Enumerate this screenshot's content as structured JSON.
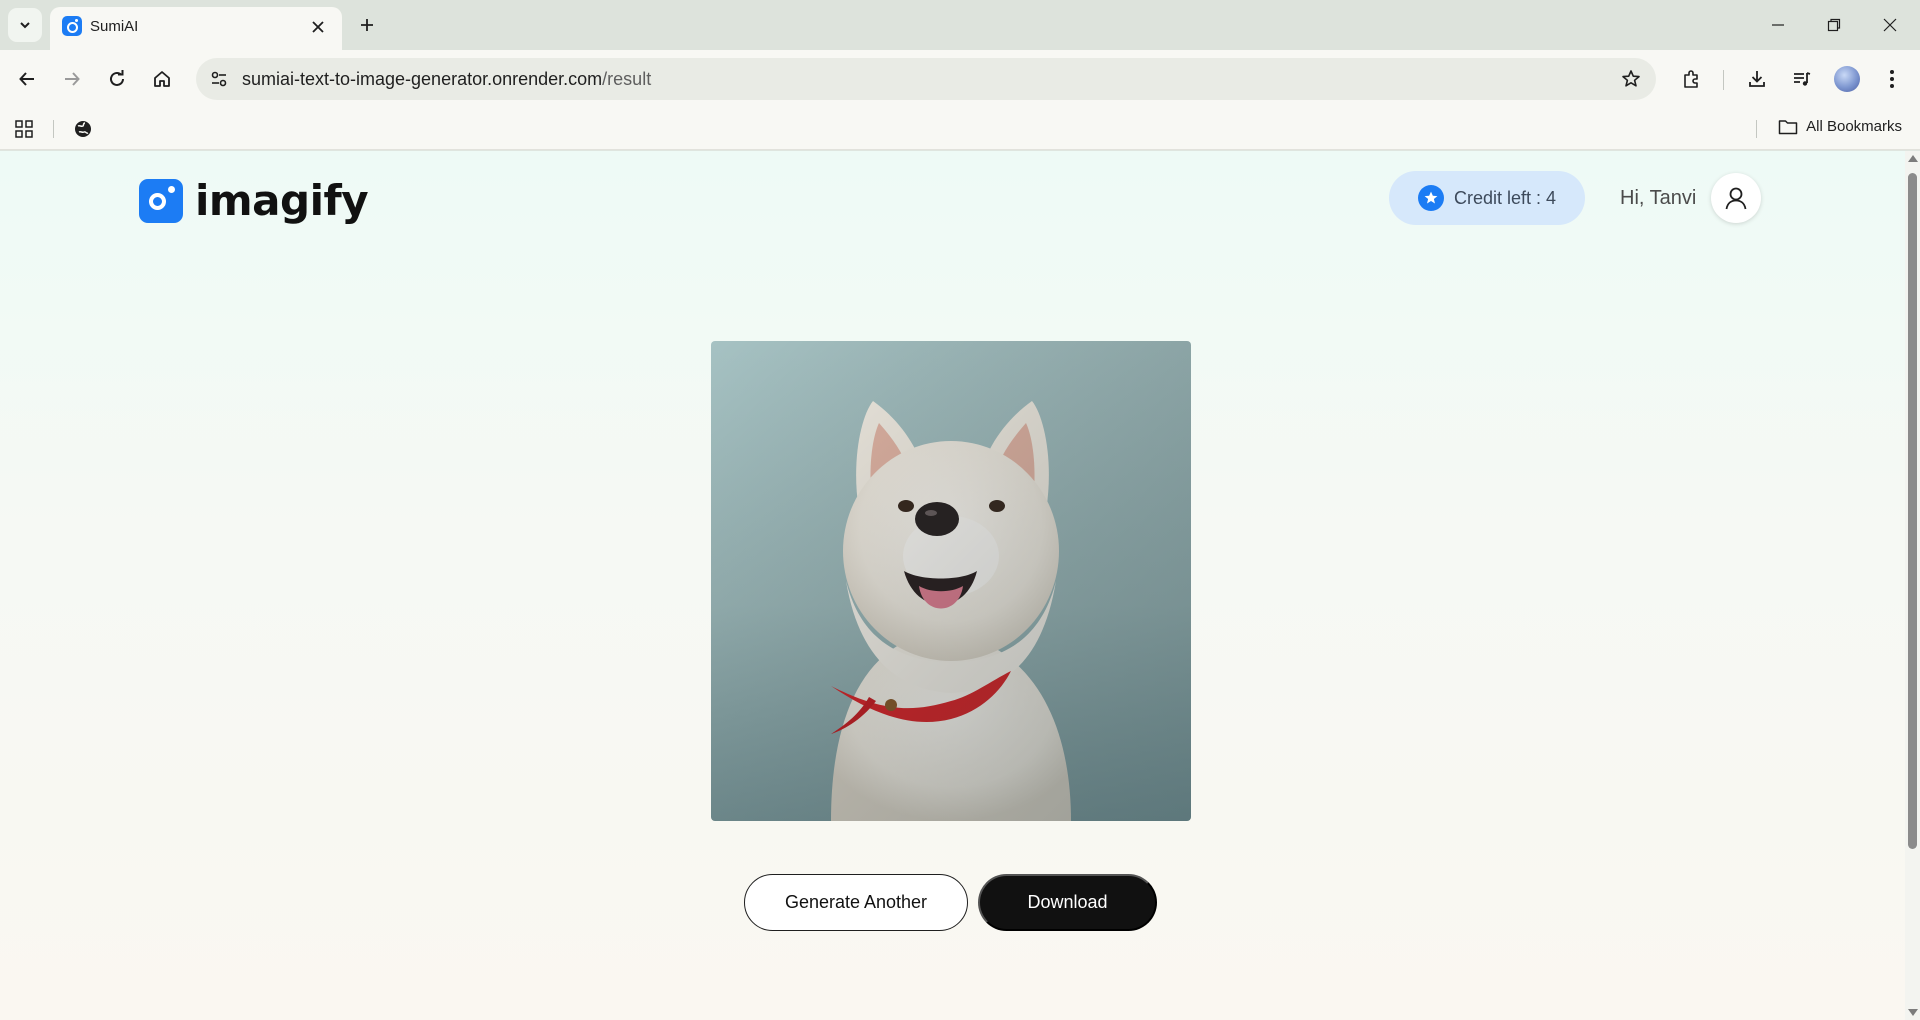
{
  "browser": {
    "tab": {
      "title": "SumiAI"
    },
    "address": {
      "host": "sumiai-text-to-image-generator.onrender.com",
      "path": "/result"
    },
    "bookmarks": {
      "all_label": "All Bookmarks"
    }
  },
  "header": {
    "logo_text": "imagify",
    "credits_label": "Credit left : 4",
    "greeting": "Hi, Tanvi"
  },
  "result": {
    "generate_another_label": "Generate Another",
    "download_label": "Download"
  },
  "colors": {
    "accent": "#1c7cf4",
    "credit_badge_bg": "#d6e8fb",
    "download_bg": "#111111"
  }
}
